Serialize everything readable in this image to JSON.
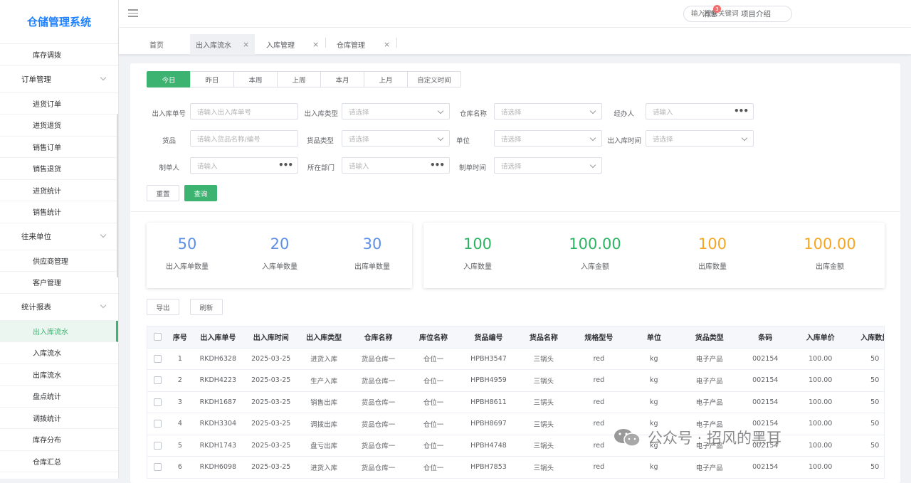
{
  "app": {
    "title": "仓储管理系统"
  },
  "sidebar": {
    "items": [
      {
        "label": "库存调拨",
        "type": "item"
      },
      {
        "label": "订单管理",
        "type": "group"
      },
      {
        "label": "进货订单",
        "type": "item"
      },
      {
        "label": "进货退货",
        "type": "item"
      },
      {
        "label": "销售订单",
        "type": "item"
      },
      {
        "label": "销售退货",
        "type": "item"
      },
      {
        "label": "进货统计",
        "type": "item"
      },
      {
        "label": "销售统计",
        "type": "item"
      },
      {
        "label": "往来单位",
        "type": "group"
      },
      {
        "label": "供应商管理",
        "type": "item"
      },
      {
        "label": "客户管理",
        "type": "item"
      },
      {
        "label": "统计报表",
        "type": "group"
      },
      {
        "label": "出入库流水",
        "type": "item",
        "active": true
      },
      {
        "label": "入库流水",
        "type": "item"
      },
      {
        "label": "出库流水",
        "type": "item"
      },
      {
        "label": "盘点统计",
        "type": "item"
      },
      {
        "label": "调拨统计",
        "type": "item"
      },
      {
        "label": "库存分布",
        "type": "item"
      },
      {
        "label": "仓库汇总",
        "type": "item"
      }
    ]
  },
  "header": {
    "search_placeholder": "输入搜索关键词",
    "messages_label": "消息",
    "messages_count": "3",
    "project_intro": "项目介绍"
  },
  "tabs": [
    {
      "label": "首页",
      "closable": false
    },
    {
      "label": "出入库流水",
      "closable": true,
      "active": true
    },
    {
      "label": "入库管理",
      "closable": true
    },
    {
      "label": "仓库管理",
      "closable": true
    }
  ],
  "date_range": [
    "今日",
    "昨日",
    "本周",
    "上周",
    "本月",
    "上月",
    "自定义时间"
  ],
  "filters": {
    "order_no": {
      "label": "出入库单号",
      "placeholder": "请输入出入库单号"
    },
    "io_type": {
      "label": "出入库类型",
      "placeholder": "请选择"
    },
    "warehouse": {
      "label": "仓库名称",
      "placeholder": "请选择"
    },
    "handler": {
      "label": "经办人",
      "placeholder": "请输入"
    },
    "goods": {
      "label": "货品",
      "placeholder": "请输入货品名称/编号"
    },
    "goods_type": {
      "label": "货品类型",
      "placeholder": "请选择"
    },
    "unit": {
      "label": "单位",
      "placeholder": "请选择"
    },
    "io_time": {
      "label": "出入库时间",
      "placeholder": "请选择"
    },
    "creator": {
      "label": "制单人",
      "placeholder": "请输入"
    },
    "department": {
      "label": "所在部门",
      "placeholder": "请输入"
    },
    "create_time": {
      "label": "制单时间",
      "placeholder": "请选择"
    }
  },
  "actions": {
    "reset": "重置",
    "query": "查询",
    "export": "导出",
    "refresh": "刷新"
  },
  "stats_left": [
    {
      "value": "50",
      "label": "出入库单数量"
    },
    {
      "value": "20",
      "label": "入库单数量"
    },
    {
      "value": "30",
      "label": "出库单数量"
    }
  ],
  "stats_right": [
    {
      "value": "100",
      "label": "入库数量"
    },
    {
      "value": "100.00",
      "label": "入库金额"
    },
    {
      "value": "100",
      "label": "出库数量"
    },
    {
      "value": "100.00",
      "label": "出库金额"
    }
  ],
  "colors": {
    "primary": "#3cb371",
    "blue_stat": "#5b8fe8",
    "green_stat": "#2bb462",
    "orange_stat": "#f5a623",
    "brand": "#1e80ff"
  },
  "table": {
    "columns": [
      "序号",
      "出入库单号",
      "出入库时间",
      "出入库类型",
      "仓库名称",
      "库位名称",
      "货品编号",
      "货品名称",
      "规格型号",
      "单位",
      "货品类型",
      "条码",
      "入库单价",
      "入库数量"
    ],
    "rows": [
      [
        "1",
        "RKDH6328",
        "2025-03-25",
        "进货入库",
        "货品仓库一",
        "仓位一",
        "HPBH3547",
        "三锅头",
        "red",
        "kg",
        "电子产品",
        "002154",
        "100.00",
        "50"
      ],
      [
        "2",
        "RKDH4223",
        "2025-03-25",
        "生产入库",
        "货品仓库一",
        "仓位一",
        "HPBH4959",
        "三锅头",
        "red",
        "kg",
        "电子产品",
        "002154",
        "100.00",
        "50"
      ],
      [
        "3",
        "RKDH1687",
        "2025-03-25",
        "销售出库",
        "货品仓库一",
        "仓位一",
        "HPBH8611",
        "三锅头",
        "red",
        "kg",
        "电子产品",
        "002154",
        "100.00",
        "50"
      ],
      [
        "4",
        "RKDH3304",
        "2025-03-25",
        "调拨出库",
        "货品仓库一",
        "仓位一",
        "HPBH8697",
        "三锅头",
        "red",
        "kg",
        "电子产品",
        "002154",
        "100.00",
        "50"
      ],
      [
        "5",
        "RKDH1743",
        "2025-03-25",
        "盘亏出库",
        "货品仓库一",
        "仓位一",
        "HPBH4748",
        "三锅头",
        "red",
        "kg",
        "电子产品",
        "002154",
        "100.00",
        "50"
      ],
      [
        "6",
        "RKDH6098",
        "2025-03-25",
        "进货入库",
        "货品仓库一",
        "仓位一",
        "HPBH7853",
        "三锅头",
        "red",
        "kg",
        "电子产品",
        "002154",
        "100.00",
        "50"
      ]
    ]
  },
  "watermark": {
    "text": "公众号 · 招风的黑耳"
  }
}
